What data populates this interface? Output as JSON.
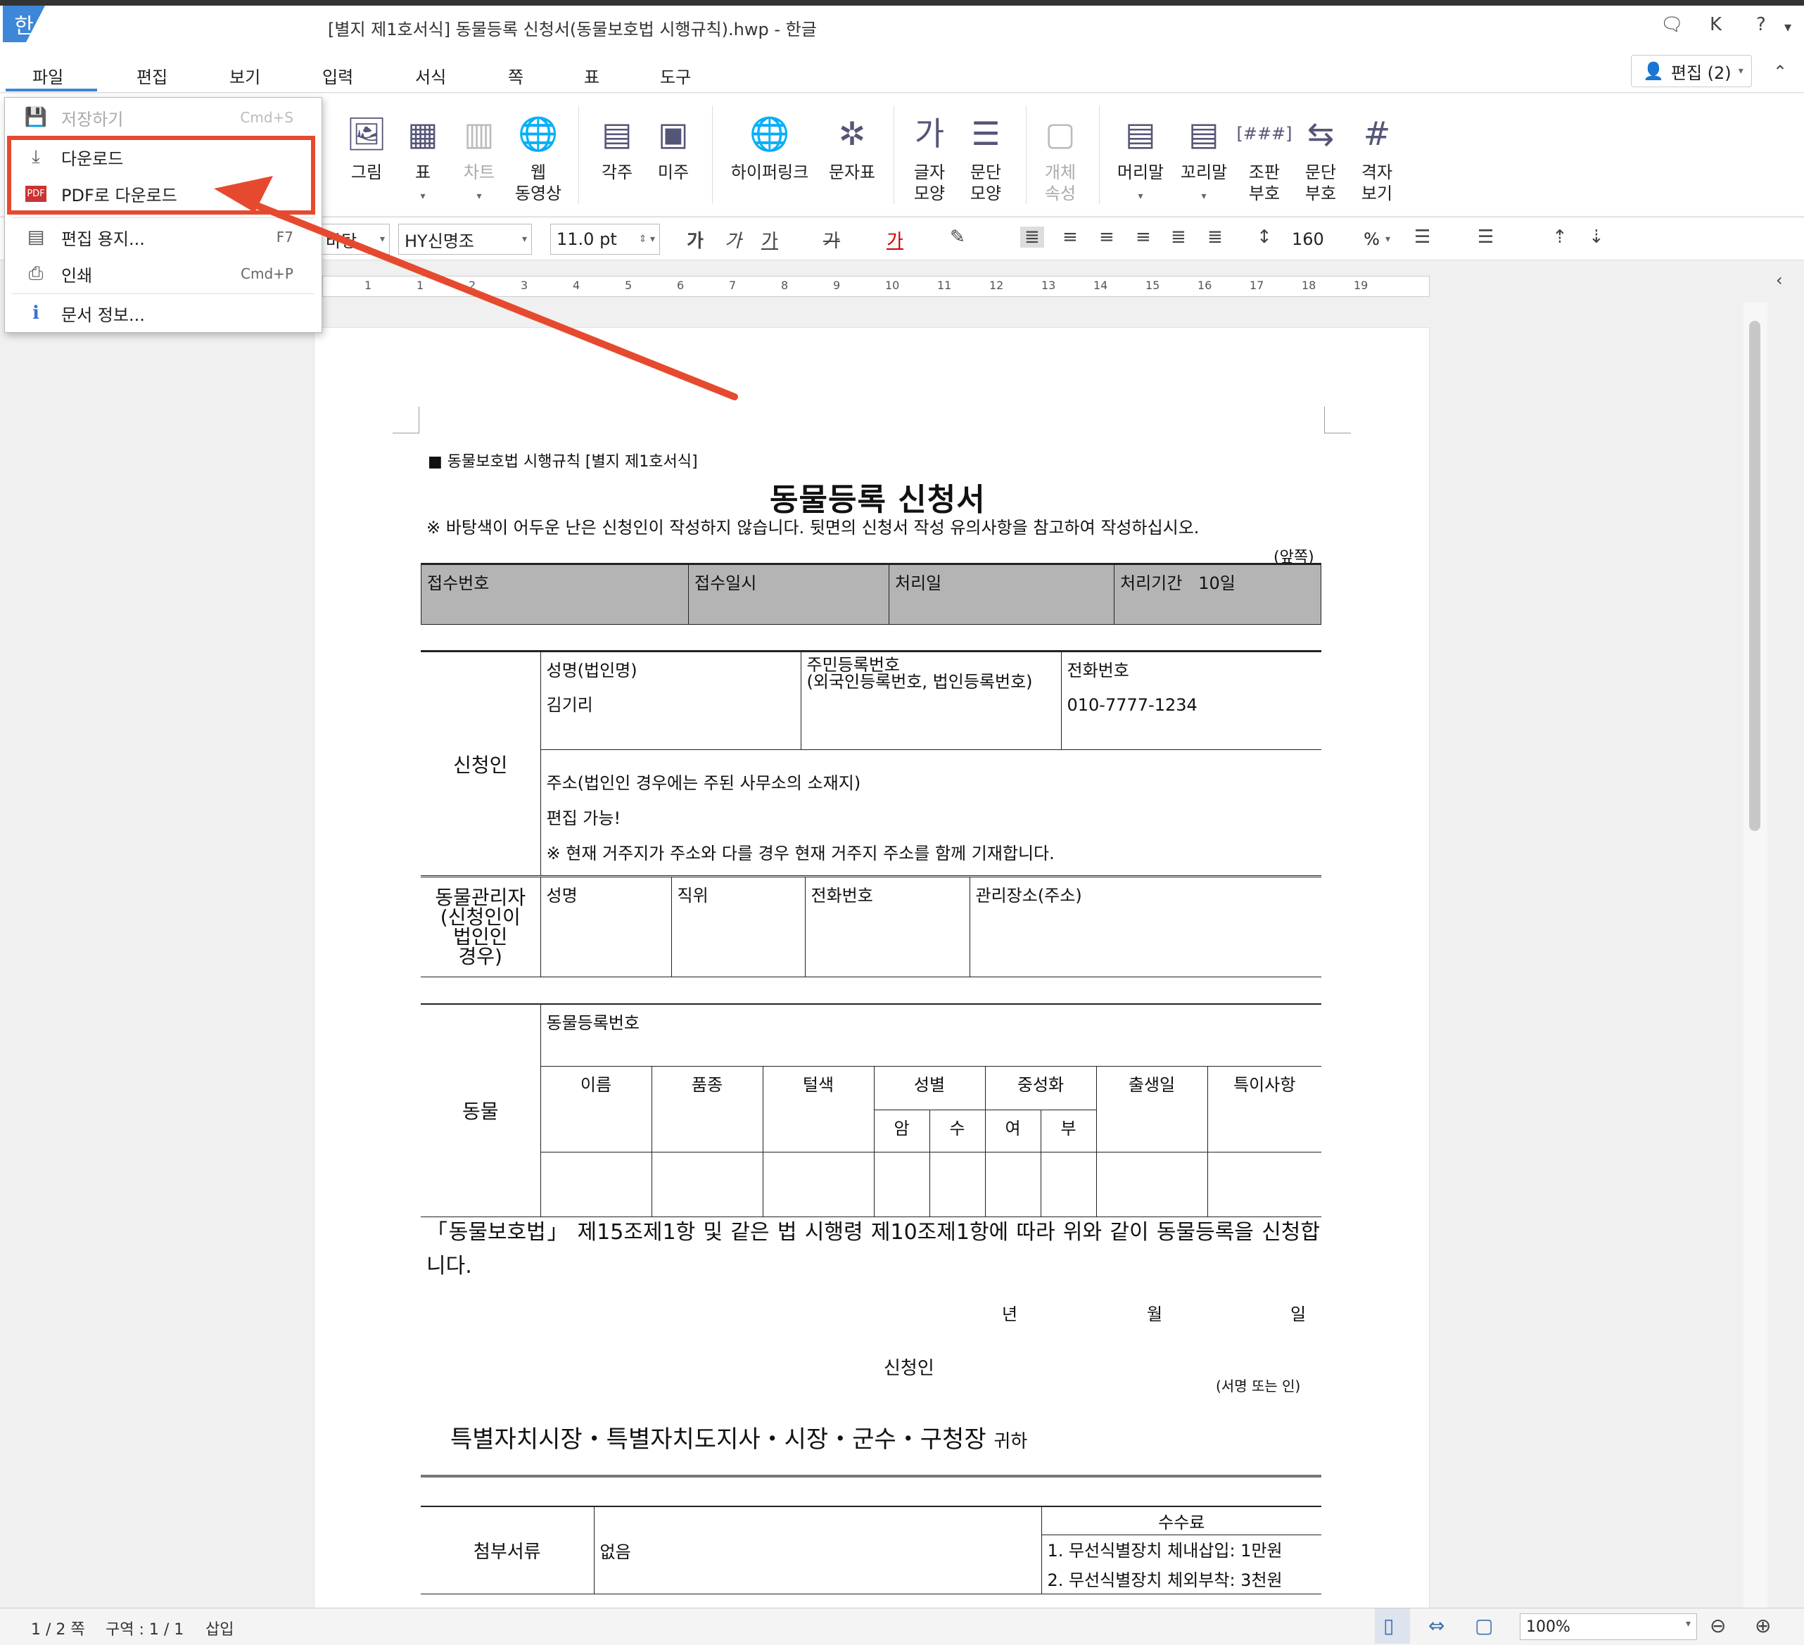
{
  "window": {
    "logo": "한",
    "title": "[별지 제1호서식] 동물등록 신청서(동물보호법 시행규칙).hwp - 한글",
    "user_initial": "K",
    "help": "?"
  },
  "menubar": {
    "items": [
      "파일",
      "편집",
      "보기",
      "입력",
      "서식",
      "쪽",
      "표",
      "도구"
    ],
    "edit_mode_label": "편집 (2)"
  },
  "ribbon": {
    "buttons": [
      {
        "label": "그림",
        "icon": "🖼"
      },
      {
        "label": "표",
        "icon": "▦"
      },
      {
        "label": "차트",
        "icon": "▥"
      },
      {
        "label": "웹\n동영상",
        "icon": "🌐"
      },
      {
        "label": "각주",
        "icon": "▤"
      },
      {
        "label": "미주",
        "icon": "▣"
      },
      {
        "label": "하이퍼링크",
        "icon": "🌐"
      },
      {
        "label": "문자표",
        "icon": "✲"
      },
      {
        "label": "글자\n모양",
        "icon": "가"
      },
      {
        "label": "문단\n모양",
        "icon": "☰"
      },
      {
        "label": "개체\n속성",
        "icon": "▢"
      },
      {
        "label": "머리말",
        "icon": "▤"
      },
      {
        "label": "꼬리말",
        "icon": "▤"
      },
      {
        "label": "조판\n부호",
        "icon": "[###]"
      },
      {
        "label": "문단\n부호",
        "icon": "⇆"
      },
      {
        "label": "격자\n보기",
        "icon": "#"
      }
    ]
  },
  "formatbar": {
    "style_value": "바탕",
    "font": "HY신명조",
    "size": "11.0",
    "size_unit": "pt",
    "bold": "가",
    "italic": "가",
    "underline": "가",
    "strike": "가",
    "color": "가",
    "line_spacing": "160",
    "line_spacing_unit": "%"
  },
  "ruler": {
    "numbers": [
      "1",
      "1",
      "2",
      "3",
      "4",
      "5",
      "6",
      "7",
      "8",
      "9",
      "10",
      "11",
      "12",
      "13",
      "14",
      "15",
      "16",
      "17",
      "18",
      "19"
    ]
  },
  "file_menu": {
    "items": [
      {
        "label": "저장하기",
        "shortcut": "Cmd+S",
        "icon": "💾",
        "disabled": true
      },
      {
        "label": "다운로드",
        "shortcut": "",
        "icon": "⤓",
        "disabled": false
      },
      {
        "label": "PDF로 다운로드",
        "shortcut": "",
        "icon": "PDF",
        "disabled": false
      },
      {
        "label": "편집 용지...",
        "shortcut": "F7",
        "icon": "▤",
        "disabled": false
      },
      {
        "label": "인쇄",
        "shortcut": "Cmd+P",
        "icon": "⎙",
        "disabled": false
      },
      {
        "label": "문서 정보...",
        "shortcut": "",
        "icon": "ℹ",
        "disabled": false
      }
    ]
  },
  "document": {
    "header": "■ 동물보호법 시행규칙 [별지 제1호서식]",
    "title": "동물등록 신청서",
    "note": "※ 바탕색이 어두운 난은 신청인이 작성하지 않습니다. 뒷면의 신청서 작성 유의사항을 참고하여 작성하십시오.",
    "front": "(앞쪽)",
    "receipt": {
      "number": "접수번호",
      "date": "접수일시",
      "processed": "처리일",
      "period_label": "처리기간",
      "period_value": "10일"
    },
    "applicant": {
      "section": "신청인",
      "name_label": "성명(법인명)",
      "name_value": "김기리",
      "rrn_label": "주민등록번호",
      "rrn_sub": "(외국인등록번호, 법인등록번호)",
      "phone_label": "전화번호",
      "phone_value": "010-7777-1234",
      "address_label": "주소(법인인 경우에는 주된 사무소의 소재지)",
      "address_value": "편집 가능!",
      "address_note": "※ 현재 거주지가 주소와 다를 경우 현재 거주지 주소를 함께 기재합니다."
    },
    "manager": {
      "section": "동물관리자\n(신청인이\n법인인\n경우)",
      "name": "성명",
      "position": "직위",
      "phone": "전화번호",
      "place": "관리장소(주소)"
    },
    "animal": {
      "section": "동물",
      "reg_no": "동물등록번호",
      "name": "이름",
      "breed": "품종",
      "color": "털색",
      "sex": "성별",
      "male": "암",
      "female": "수",
      "neuter": "중성화",
      "yes": "여",
      "no": "부",
      "birth": "출생일",
      "special": "특이사항"
    },
    "declaration": "「동물보호법」 제15조제1항 및 같은 법 시행령 제10조제1항에 따라 위와 같이 동물등록을 신청합니다.",
    "year": "년",
    "month": "월",
    "day": "일",
    "applicant_sign": "신청인",
    "sign_note": "(서명 또는 인)",
    "recipient": "특별자치시장・특별자치도지사・시장・군수・구청장",
    "recipient_suffix": "귀하",
    "attachments": {
      "label": "첨부서류",
      "value": "없음",
      "fee_label": "수수료",
      "fee1": "1. 무선식별장치 체내삽입: 1만원",
      "fee2": "2. 무선식별장치 체외부착: 3천원"
    }
  },
  "statusbar": {
    "page": "1 / 2 쪽",
    "section": "구역 : 1 / 1",
    "mode": "삽입",
    "zoom": "100%"
  },
  "colors": {
    "accent": "#3d86d8",
    "annotation": "#e64a2e",
    "shaded_cell": "#b4b4b4"
  }
}
